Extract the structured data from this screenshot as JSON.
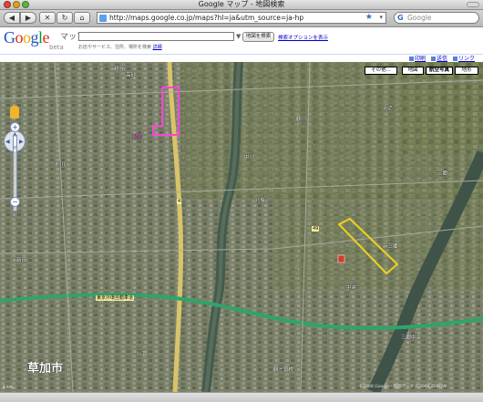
{
  "window": {
    "title": "Google マップ - 地図検索"
  },
  "browser": {
    "url": "http://maps.google.co.jp/maps?hl=ja&utm_source=ja-hp",
    "search_label": "Google",
    "nav_glyphs": {
      "back": "◀",
      "forward": "▶",
      "stop": "✕",
      "reload": "↻",
      "home": "⌂"
    }
  },
  "google": {
    "logo": "Google",
    "product": "マップ",
    "beta": "beta",
    "query_value": "",
    "search_button": "地図を検索",
    "search_options": "検索オプションを表示",
    "hint": "お店やサービス、住所、場所を検索",
    "hint_link": "詳細"
  },
  "links": {
    "print": "印刷",
    "mail": "送信",
    "link": "リンク"
  },
  "map_types": [
    {
      "label": "その他...",
      "active": false
    },
    {
      "label": "地図",
      "active": false
    },
    {
      "label": "航空写真",
      "active": true
    },
    {
      "label": "地形",
      "active": false
    }
  ],
  "map": {
    "labels": {
      "city_soka": "草加市",
      "city_area": "高砂",
      "road_tokyo_gaikan": "東京外環自動車道",
      "road_r4": "4",
      "road_49": "49",
      "pink_label": "松原",
      "shin_misato": "新三郷",
      "misato": "三郷",
      "yashio": "八潮",
      "koshigaya": "越谷",
      "misato_chuo": "三郷中央",
      "nakagawa": "中川",
      "chuo": "中央",
      "tsurugaya": "鶴ヶ曽根",
      "shinden": "新田",
      "hikawa": "氷川",
      "kamikura": "上之",
      "hachijo": "八条",
      "tsurukawa": "鶴川"
    },
    "copyright": "©2008 Google - 地図データ ©2008 ZENRIN",
    "scale": "1 km"
  }
}
